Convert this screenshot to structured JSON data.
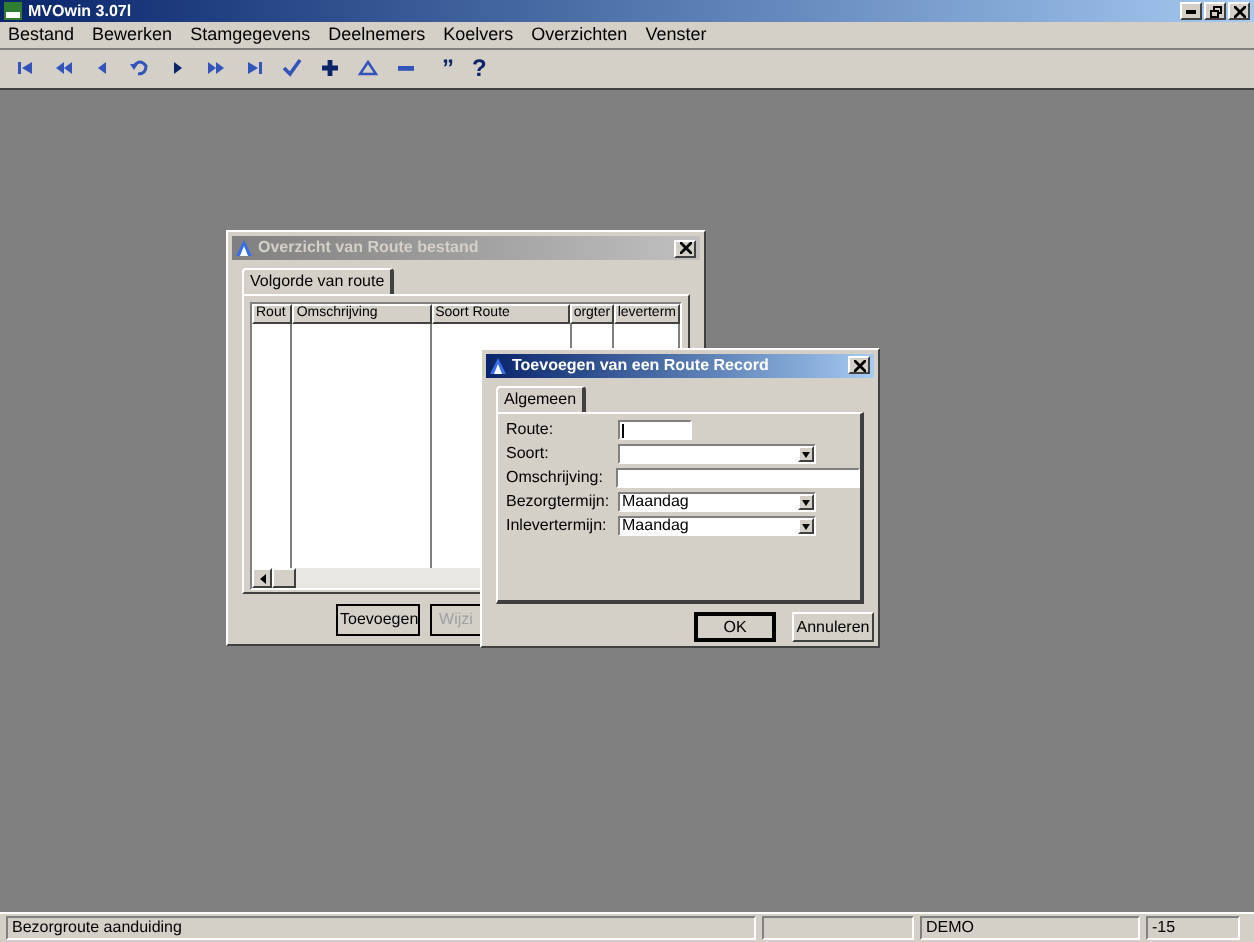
{
  "app": {
    "title": "MVOwin 3.07l"
  },
  "menu": [
    "Bestand",
    "Bewerken",
    "Stamgegevens",
    "Deelnemers",
    "Koelvers",
    "Overzichten",
    "Venster"
  ],
  "toolbar_text": [
    "”",
    "?"
  ],
  "overview_window": {
    "title": "Overzicht van Route bestand",
    "active": false,
    "tabs": [
      {
        "label": "Volgorde van route",
        "selected": true
      }
    ],
    "columns": [
      "Rout",
      "Omschrijving",
      "Soort Route",
      "orgter",
      "leverterm"
    ],
    "buttons": [
      {
        "label": "Toevoegen",
        "disabled": false
      },
      {
        "label": "Wijzi",
        "disabled": true
      }
    ]
  },
  "record_window": {
    "title": "Toevoegen van een Route Record",
    "active": true,
    "tabs": [
      {
        "label": "Algemeen",
        "selected": true
      }
    ],
    "fields": [
      {
        "label": "Route:",
        "kind": "short"
      },
      {
        "label": "Soort:",
        "kind": "combo"
      },
      {
        "label": "Omschrijving:",
        "kind": "text"
      },
      {
        "label": "Bezorgtermijn:",
        "kind": "combo",
        "value": "Maandag"
      },
      {
        "label": "Inlevertermijn:",
        "kind": "combo",
        "value": "Maandag"
      }
    ],
    "buttons": [
      {
        "label": "OK",
        "default": true
      },
      {
        "label": "Annuleren",
        "default": false
      }
    ]
  },
  "status_bar": [
    "Bezorgroute aanduiding",
    "DEMO",
    "-15"
  ]
}
